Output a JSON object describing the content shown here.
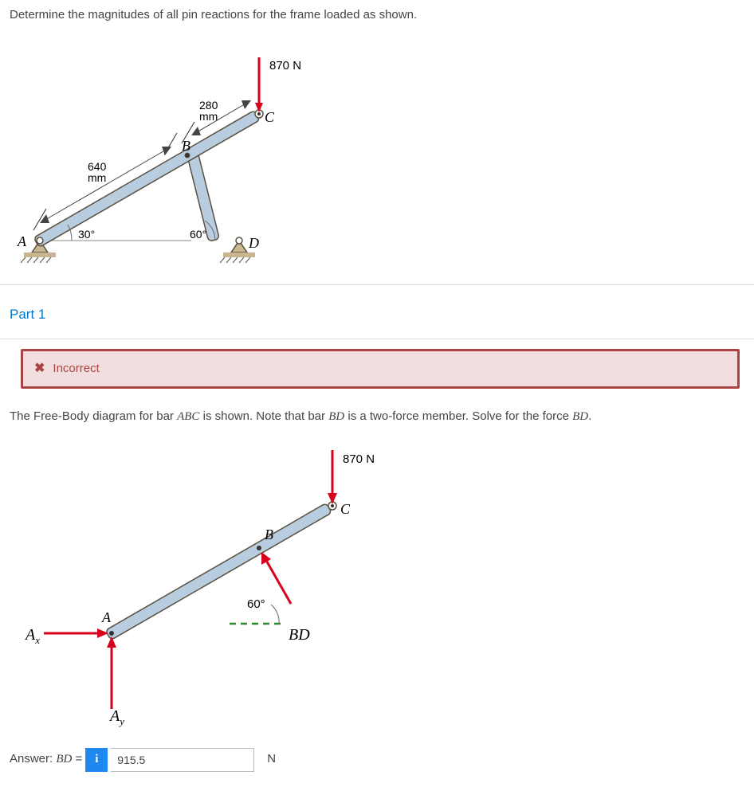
{
  "question": "Determine the magnitudes of all pin reactions for the frame loaded as shown.",
  "figure1": {
    "force_label": "870 N",
    "dim_bc": "280",
    "dim_bc_unit": "mm",
    "dim_ab": "640",
    "dim_ab_unit": "mm",
    "angle_a": "30°",
    "angle_d": "60°",
    "pt_a": "A",
    "pt_b": "B",
    "pt_c": "C",
    "pt_d": "D"
  },
  "part1": {
    "title": "Part 1",
    "feedback": "Incorrect",
    "instruction_prefix": "The Free-Body diagram for bar ",
    "instruction_bar1": "ABC",
    "instruction_mid": " is shown. Note that bar ",
    "instruction_bar2": "BD",
    "instruction_mid2": " is a two-force member. Solve for the force ",
    "instruction_bar3": "BD",
    "instruction_suffix": "."
  },
  "figure2": {
    "force_label": "870 N",
    "angle_b": "60°",
    "pt_a": "A",
    "pt_b": "B",
    "pt_c": "C",
    "ax": "A",
    "ax_sub": "x",
    "ay": "A",
    "ay_sub": "y",
    "bd": "BD"
  },
  "answer": {
    "label_prefix": "Answer: ",
    "label_var": "BD",
    "label_eq": " = ",
    "value": "915.5",
    "unit": "N"
  }
}
